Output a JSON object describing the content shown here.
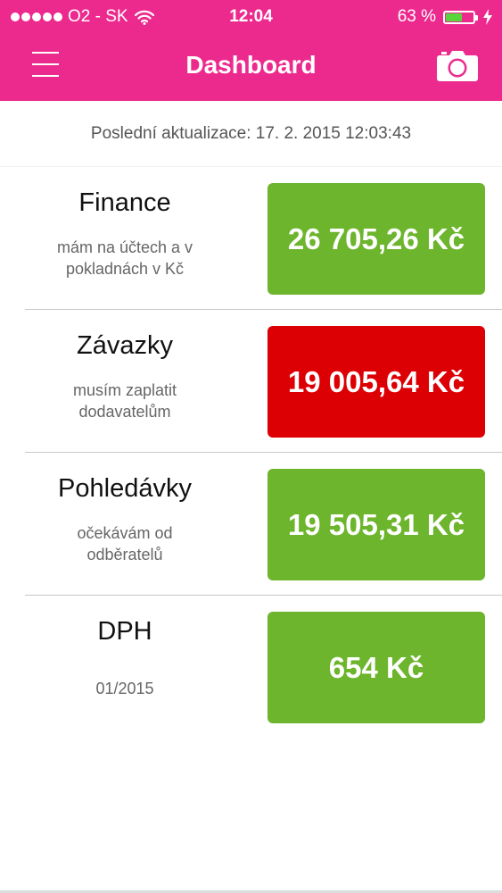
{
  "status_bar": {
    "carrier": "O2 - SK",
    "time": "12:04",
    "battery_percent": "63 %",
    "battery_level": 0.63,
    "battery_color": "#5ad43c"
  },
  "nav": {
    "title": "Dashboard",
    "background_color": "#ec2a8e"
  },
  "last_update": "Poslední aktualizace: 17. 2. 2015 12:03:43",
  "colors": {
    "positive": "#6cb52c",
    "negative": "#dc0005"
  },
  "rows": [
    {
      "title": "Finance",
      "subtitle_line1": "mám na účtech a v",
      "subtitle_line2": "pokladnách v Kč",
      "value": "26 705,26 Kč",
      "status": "positive"
    },
    {
      "title": "Závazky",
      "subtitle_line1": "musím zaplatit",
      "subtitle_line2": "dodavatelům",
      "value": "19 005,64 Kč",
      "status": "negative"
    },
    {
      "title": "Pohledávky",
      "subtitle_line1": "očekávám od",
      "subtitle_line2": "odběratelů",
      "value": "19 505,31 Kč",
      "status": "positive"
    },
    {
      "title": "DPH",
      "subtitle_line1": "01/2015",
      "subtitle_line2": "",
      "value": "654 Kč",
      "status": "positive"
    }
  ],
  "icons": {
    "menu": "hamburger-menu-icon",
    "camera": "camera-icon",
    "wifi": "wifi-icon",
    "charging": "charging-bolt-icon"
  }
}
